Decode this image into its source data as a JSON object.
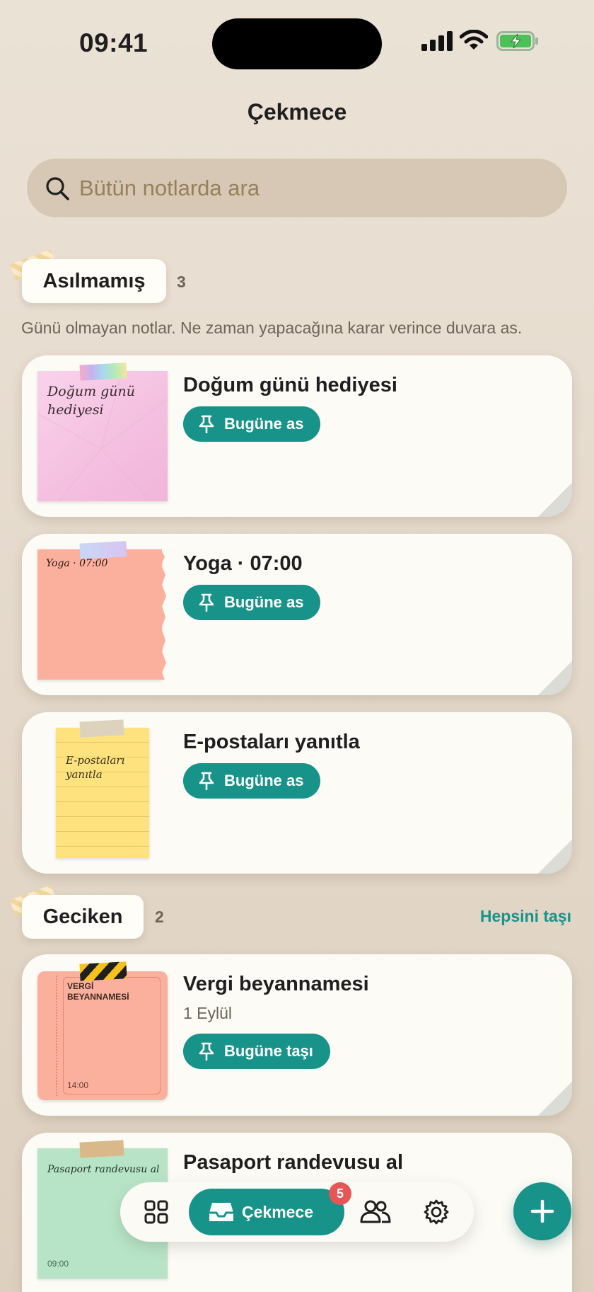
{
  "status": {
    "time": "09:41"
  },
  "header": {
    "title": "Çekmece"
  },
  "search": {
    "placeholder": "Bütün notlarda ara"
  },
  "unpinned": {
    "label": "Asılmamış",
    "count": "3",
    "description": "Günü olmayan notlar. Ne zaman yapacağına karar verince duvara as.",
    "items": [
      {
        "title": "Doğum günü hediyesi",
        "note_text": "Doğum günü hediyesi",
        "action": "Bugüne as",
        "note_color": "#f7c9e3"
      },
      {
        "title": "Yoga · 07:00",
        "note_text": "Yoga · 07:00",
        "action": "Bugüne as",
        "note_color": "#fbb09e"
      },
      {
        "title": "E-postaları yanıtla",
        "note_text": "E-postaları yanıtla",
        "action": "Bugüne as",
        "note_color": "#fde27e"
      }
    ]
  },
  "overdue": {
    "label": "Geciken",
    "count": "2",
    "move_all": "Hepsini taşı",
    "items": [
      {
        "title": "Vergi beyannamesi",
        "date": "1 Eylül",
        "note_text": "VERGİ BEYANNAMESİ",
        "note_time": "14:00",
        "action": "Bugüne taşı",
        "note_color": "#fbb09e"
      },
      {
        "title": "Pasaport randevusu al",
        "note_text": "Pasaport randevusu al",
        "note_time": "09:00",
        "note_color": "#b7e4c7"
      }
    ]
  },
  "nav": {
    "active_label": "Çekmece",
    "badge": "5",
    "icons": [
      "grid-icon",
      "drawer-icon",
      "people-icon",
      "gear-icon"
    ]
  },
  "colors": {
    "accent": "#17938a",
    "badge": "#e65656",
    "card": "#fcfbf6"
  }
}
